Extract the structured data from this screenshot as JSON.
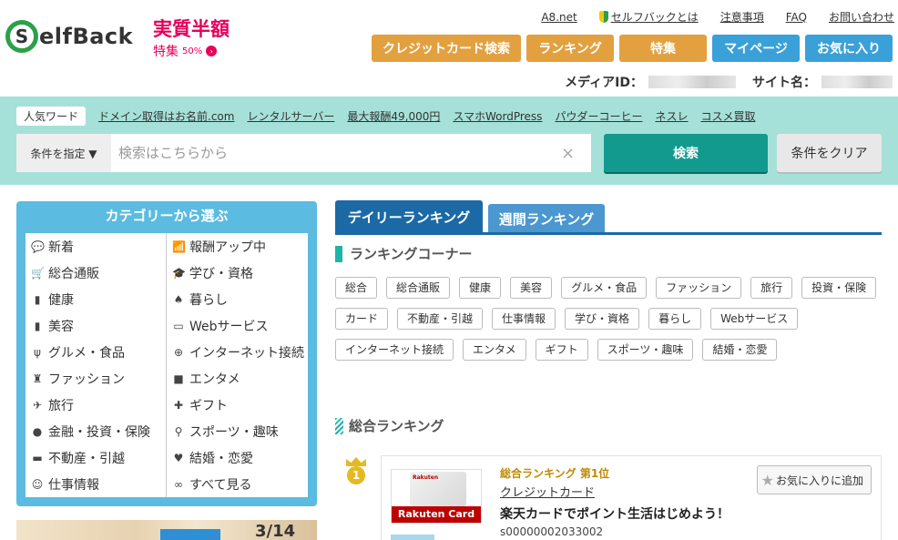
{
  "brand": {
    "logo_letter": "S",
    "logo_text": "elfBack"
  },
  "promo": {
    "title": "実質半額",
    "sub": "特集",
    "badge": "50%",
    "arrow": "›"
  },
  "toplinks": [
    {
      "label": "A8.net"
    },
    {
      "label": "セルフバックとは"
    },
    {
      "label": "注意事項"
    },
    {
      "label": "FAQ"
    },
    {
      "label": "お問い合わせ"
    }
  ],
  "nav": [
    {
      "label": "クレジットカード検索",
      "color": "#e3a03f"
    },
    {
      "label": "ランキング",
      "color": "#e3a03f"
    },
    {
      "label": "特集",
      "color": "#e3a03f"
    },
    {
      "label": "マイページ",
      "color": "#3aa0d8"
    },
    {
      "label": "お気に入り",
      "color": "#3aa0d8"
    }
  ],
  "media": {
    "id_label": "メディアID：",
    "site_label": "サイト名："
  },
  "search": {
    "keywords_label": "人気ワード",
    "keywords": [
      "ドメイン取得はお名前.com",
      "レンタルサーバー",
      "最大報酬49,000円",
      "スマホWordPress",
      "パウダーコーヒー",
      "ネスレ",
      "コスメ買取"
    ],
    "condition_label": "条件を指定 ▼",
    "placeholder": "検索はこちらから",
    "clear_x": "×",
    "search_button": "検索",
    "clear_button": "条件をクリア"
  },
  "category": {
    "title": "カテゴリーから選ぶ",
    "items": [
      {
        "label": "新着",
        "icon": "speech-bubble-icon",
        "glyph": "💬"
      },
      {
        "label": "報酬アップ中",
        "icon": "bar-chart-icon",
        "glyph": "📶"
      },
      {
        "label": "総合通販",
        "icon": "cart-icon",
        "glyph": "🛒"
      },
      {
        "label": "学び・資格",
        "icon": "graduation-cap-icon",
        "glyph": "🎓"
      },
      {
        "label": "健康",
        "icon": "bottle-icon",
        "glyph": "▮"
      },
      {
        "label": "暮らし",
        "icon": "tree-icon",
        "glyph": "♠"
      },
      {
        "label": "美容",
        "icon": "lipstick-icon",
        "glyph": "▮"
      },
      {
        "label": "Webサービス",
        "icon": "monitor-icon",
        "glyph": "▭"
      },
      {
        "label": "グルメ・食品",
        "icon": "fork-knife-icon",
        "glyph": "ψ"
      },
      {
        "label": "インターネット接続",
        "icon": "globe-icon",
        "glyph": "⊕"
      },
      {
        "label": "ファッション",
        "icon": "dress-icon",
        "glyph": "♜"
      },
      {
        "label": "エンタメ",
        "icon": "camera-icon",
        "glyph": "■"
      },
      {
        "label": "旅行",
        "icon": "airplane-icon",
        "glyph": "✈"
      },
      {
        "label": "ギフト",
        "icon": "gift-icon",
        "glyph": "✚"
      },
      {
        "label": "金融・投資・保険",
        "icon": "money-bag-icon",
        "glyph": "●"
      },
      {
        "label": "スポーツ・趣味",
        "icon": "racket-icon",
        "glyph": "⚲"
      },
      {
        "label": "不動産・引越",
        "icon": "truck-icon",
        "glyph": "▬"
      },
      {
        "label": "結婚・恋愛",
        "icon": "heart-icon",
        "glyph": "♥"
      },
      {
        "label": "仕事情報",
        "icon": "person-icon",
        "glyph": "☺"
      },
      {
        "label": "すべて見る",
        "icon": "binoculars-icon",
        "glyph": "∞"
      }
    ]
  },
  "banner": {
    "date": "3/14"
  },
  "tabs": {
    "daily": "デイリーランキング",
    "weekly": "週間ランキング"
  },
  "ranking_corner": {
    "title": "ランキングコーナー",
    "tags": [
      "総合",
      "総合通販",
      "健康",
      "美容",
      "グルメ・食品",
      "ファッション",
      "旅行",
      "投資・保険",
      "カード",
      "不動産・引越",
      "仕事情報",
      "学び・資格",
      "暮らし",
      "Webサービス",
      "インターネット接続",
      "エンタメ",
      "ギフト",
      "スポーツ・趣味",
      "結婚・恋愛"
    ]
  },
  "overall": {
    "title": "総合ランキング",
    "first": {
      "rank_number": "1",
      "rank_label": "総合ランキング 第1位",
      "category": "クレジットカード",
      "heading": "楽天カードでポイント生活はじめよう！",
      "id": "s00000002033002",
      "card_brand": "Rakuten Card",
      "card_logo": "Rakuten",
      "fav_label": "お気に入りに追加"
    }
  }
}
